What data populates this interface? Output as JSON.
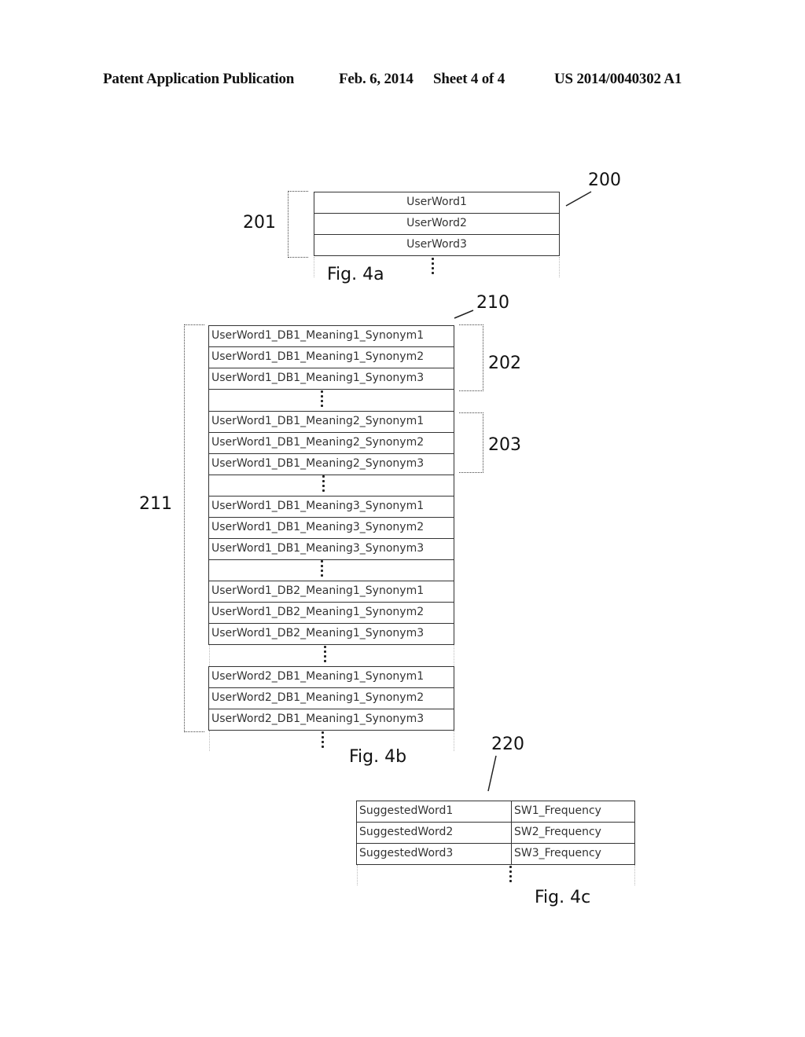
{
  "header": {
    "publication": "Patent Application Publication",
    "date": "Feb. 6, 2014",
    "sheet": "Sheet 4 of 4",
    "number": "US 2014/0040302 A1"
  },
  "fig4a": {
    "caption": "Fig. 4a",
    "ref_table": "200",
    "ref_bracket": "201",
    "rows": [
      "UserWord1",
      "UserWord2",
      "UserWord3"
    ]
  },
  "fig4b": {
    "caption": "Fig. 4b",
    "ref_table": "210",
    "ref_outer_bracket": "211",
    "ref_group1": "202",
    "ref_group2": "203",
    "groups": [
      [
        "UserWord1_DB1_Meaning1_Synonym1",
        "UserWord1_DB1_Meaning1_Synonym2",
        "UserWord1_DB1_Meaning1_Synonym3"
      ],
      [
        "UserWord1_DB1_Meaning2_Synonym1",
        "UserWord1_DB1_Meaning2_Synonym2",
        "UserWord1_DB1_Meaning2_Synonym3"
      ],
      [
        "UserWord1_DB1_Meaning3_Synonym1",
        "UserWord1_DB1_Meaning3_Synonym2",
        "UserWord1_DB1_Meaning3_Synonym3"
      ],
      [
        "UserWord1_DB2_Meaning1_Synonym1",
        "UserWord1_DB2_Meaning1_Synonym2",
        "UserWord1_DB2_Meaning1_Synonym3"
      ],
      [
        "UserWord2_DB1_Meaning1_Synonym1",
        "UserWord2_DB1_Meaning1_Synonym2",
        "UserWord2_DB1_Meaning1_Synonym3"
      ]
    ]
  },
  "fig4c": {
    "caption": "Fig. 4c",
    "ref_table": "220",
    "rows": [
      {
        "word": "SuggestedWord1",
        "frequency": "SW1_Frequency"
      },
      {
        "word": "SuggestedWord2",
        "frequency": "SW2_Frequency"
      },
      {
        "word": "SuggestedWord3",
        "frequency": "SW3_Frequency"
      }
    ]
  }
}
